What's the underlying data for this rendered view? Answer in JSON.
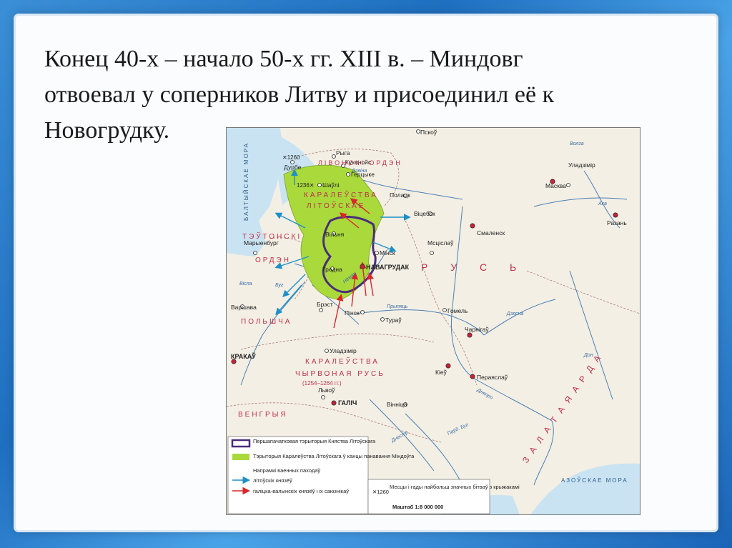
{
  "slide": {
    "title_lines": [
      "Конец 40-х – начало 50-х гг.  XIII в. – Миндовг",
      "отвоевал у соперников Литву и присоединил её к",
      "Новогрудку."
    ]
  },
  "map": {
    "cities": {
      "pskou": "Пскоў",
      "ryga": "Рыга",
      "kukenois": "Кукенойс",
      "gertsyke": "Герцыке",
      "durbe": "Дурбе",
      "shauli": "Шаўлі",
      "polatsk": "Полацк",
      "vitsebsk": "Віцебск",
      "smalensk": "Смаленск",
      "uladzimir_n": "Уладзімір",
      "maskva": "Масква",
      "razan": "Разань",
      "vilnia": "Вільня",
      "minsk": "Мінск",
      "mstsislau": "Мсціслаў",
      "grodna": "Гродна",
      "navagrudak": "НАВАГРУДАК",
      "marienburg": "Марыенбург",
      "varshava": "Варшава",
      "brest": "Брэст",
      "pinsk": "Пінск",
      "turau": "Тураў",
      "gomel": "Гомель",
      "charnigau": "Чарнігаў",
      "uladzimir_s": "Уладзімір",
      "krakau": "КРАКАЎ",
      "lvou": "Львоў",
      "kieu": "Кіеў",
      "pereyaslau": "Пераяслаў",
      "galich": "ГАЛІЧ",
      "vinitsa": "Вінніца"
    },
    "regions": {
      "livonski_orden": "ЛІВОНСКІ ОРДЭН",
      "karaleustva_litouskae_1": "КАРАЛЕЎСТВА",
      "karaleustva_litouskae_2": "ЛІТОЎСКАЕ",
      "teutonski_orden_1": "ТЭЎТОНСКІ",
      "teutonski_orden_2": "ОРДЭН",
      "polshcha": "ПОЛЬШЧА",
      "rus": "Р У С Ь",
      "chyrvonaya_rus_1": "КАРАЛЕЎСТВА",
      "chyrvonaya_rus_2": "ЧЫРВОНАЯ РУСЬ",
      "chyrvonaya_rus_years": "(1254–1264 гг.)",
      "vengryya": "ВЕНГРЫЯ",
      "zalataya_arda": "З А Л А Т А Я   А Р Д А"
    },
    "seas": {
      "baltic": "БАЛТЫЙСКАЕ МОРА",
      "azov": "АЗОЎСКАЕ МОРА"
    },
    "rivers": {
      "dzvina": "Дзвіна",
      "neman": "Нёман",
      "bug": "Буг",
      "visla": "Вісла",
      "prypiats": "Прыпяць",
      "dnepr": "Дняпро",
      "dnestr": "Днестр",
      "desna": "Дзясна",
      "don": "Дон",
      "oka": "Ака",
      "volga": "Волга",
      "pivdenny_bug": "Паўд. Буг"
    },
    "battles": [
      {
        "year": "1260"
      },
      {
        "year": "1236"
      }
    ],
    "legend": {
      "initial_territory": "Першапачатковая тэрыторыя Княства Літоўскага",
      "kingdom_territory": "Тэрыторыя Каралеўства Літоўскага ў канцы панавання Міндоўга",
      "campaigns_heading": "Напрамкі ваенных паходаў",
      "lithuanian_princes": "літоўскіх князёў",
      "galician_princes": "галіцка-валынскіх князёў і іх саюзнікаў",
      "battle_year_example": "1260",
      "battles_text": "Месцы і гады найбольш значных бітваў з крыжакамі",
      "scale": "Маштаб 1:8 000 000"
    },
    "colors": {
      "kingdom_fill": "#a9d93b",
      "initial_border": "#4a2d7a",
      "lithuanian_arrow": "#1e90c8",
      "galician_arrow": "#d9262a",
      "land": "#f3efe4",
      "sea": "#c9e3f2"
    }
  }
}
